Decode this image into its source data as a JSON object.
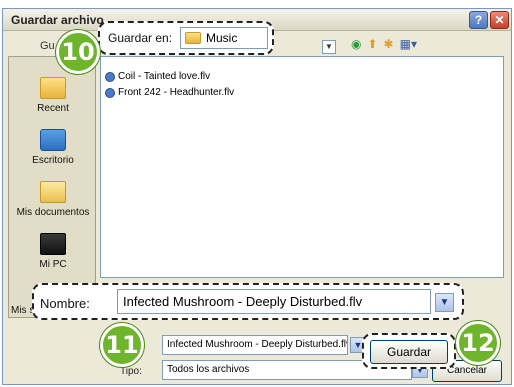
{
  "dialog": {
    "title": "Guardar archivo",
    "help_label": "?",
    "close_label": "✕"
  },
  "top": {
    "look_in_label": "Guardar en:",
    "folder_name": "Music",
    "partial_label": "Gu"
  },
  "places": [
    {
      "label": "Recent"
    },
    {
      "label": "Escritorio"
    },
    {
      "label": "Mis documentos"
    },
    {
      "label": "Mi PC"
    },
    {
      "label": "Mis sitios de red"
    }
  ],
  "files": [
    {
      "name": "Coil - Tainted love.flv"
    },
    {
      "name": "Front 242 - Headhunter.flv"
    }
  ],
  "bottom": {
    "filename_label": "Nombre:",
    "filename_value": "Infected Mushroom - Deeply Disturbed.flv",
    "filename_small_value": "Infected Mushroom - Deeply Disturbed.flv",
    "type_label": "Tipo:",
    "type_value": "Todos los archivos",
    "save_label": "Guardar",
    "cancel_label": "Cancelar"
  },
  "callouts": {
    "badge_10": "10",
    "badge_11": "11",
    "badge_12": "12"
  },
  "icons": [
    "back-icon",
    "up-folder-icon",
    "new-folder-icon",
    "views-menu-icon",
    "help-icon",
    "close-icon",
    "folder-icon",
    "flv-file-icon"
  ]
}
